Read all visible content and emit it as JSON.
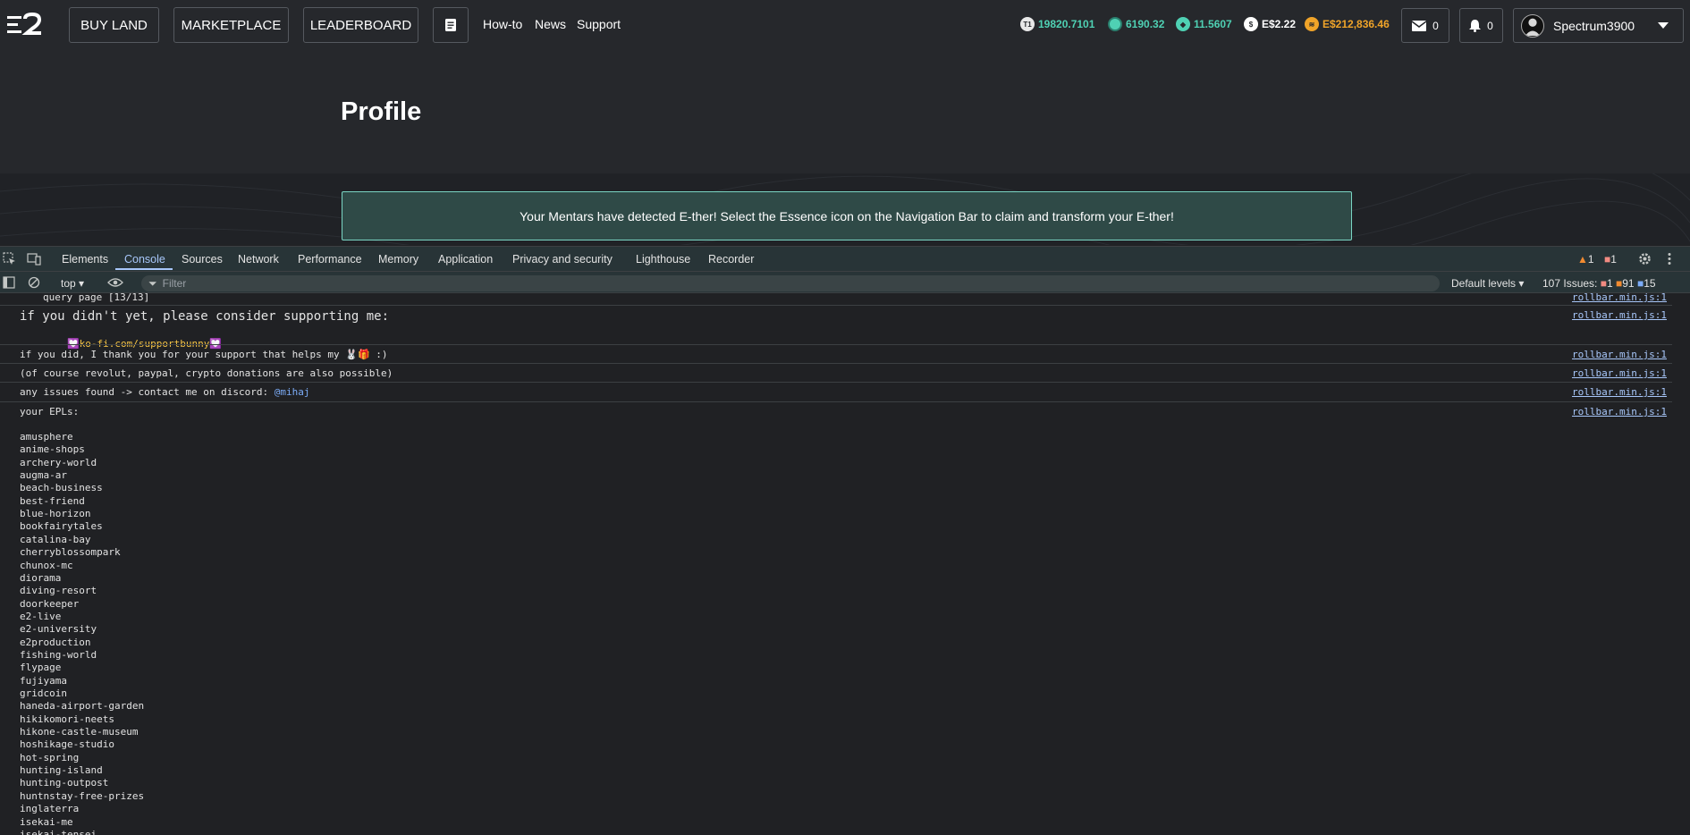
{
  "nav": {
    "buttons": [
      "BUY LAND",
      "MARKETPLACE",
      "LEADERBOARD"
    ],
    "links": [
      "How-to",
      "News",
      "Support"
    ],
    "stats": [
      {
        "value": "19820.7101",
        "color": "#4fd1b4",
        "icon": "tile-icon"
      },
      {
        "value": "6190.32",
        "color": "#4fd1b4",
        "icon": "essence-icon"
      },
      {
        "value": "11.5607",
        "color": "#4fd1b4",
        "icon": "ether-icon"
      },
      {
        "value": "E$2.22",
        "color": "#ffffff",
        "icon": "dollar-icon"
      },
      {
        "value": "E$212,836.46",
        "color": "#f0a429",
        "icon": "coin-icon"
      }
    ],
    "mail_count": "0",
    "notif_count": "0",
    "username": "Spectrum3900"
  },
  "page": {
    "title": "Profile",
    "banner": "Your Mentars have detected E-ther! Select the Essence icon on the Navigation Bar to claim and transform your E-ther!"
  },
  "devtools": {
    "tabs": [
      "Elements",
      "Console",
      "Sources",
      "Network",
      "Performance",
      "Memory",
      "Application",
      "Privacy and security",
      "Lighthouse",
      "Recorder"
    ],
    "active_tab": "Console",
    "warn_count": "1",
    "error_count": "1",
    "context": "top",
    "filter_placeholder": "Filter",
    "levels": "Default levels",
    "issues_label": "107 Issues:",
    "issues_errors": "1",
    "issues_warnings": "91",
    "issues_info": "15"
  },
  "console": {
    "source": "rollbar.min.js:1",
    "query_page": "query page [13/13]",
    "support_line": "if you didn't yet, please consider supporting me:",
    "kofi": "ko-fi.com/supportbunny",
    "thanks_line": "if you did, I thank you for your support that helps my",
    "thanks_tail": ":)",
    "course_line": "(of course revolut, paypal, crypto donations are also possible)",
    "issues_line": "any issues found -> contact me on discord:",
    "discord": "@mihaj",
    "epls_title": "your EPLs:",
    "epls": [
      "amusphere",
      "anime-shops",
      "archery-world",
      "augma-ar",
      "beach-business",
      "best-friend",
      "blue-horizon",
      "bookfairytales",
      "catalina-bay",
      "cherryblossompark",
      "chunox-mc",
      "diorama",
      "diving-resort",
      "doorkeeper",
      "e2-live",
      "e2-university",
      "e2production",
      "fishing-world",
      "flypage",
      "fujiyama",
      "gridcoin",
      "haneda-airport-garden",
      "hikikomori-neets",
      "hikone-castle-museum",
      "hoshikage-studio",
      "hot-spring",
      "hunting-island",
      "hunting-outpost",
      "huntnstay-free-prizes",
      "inglaterra",
      "isekai-me",
      "isekai-tensei"
    ]
  }
}
